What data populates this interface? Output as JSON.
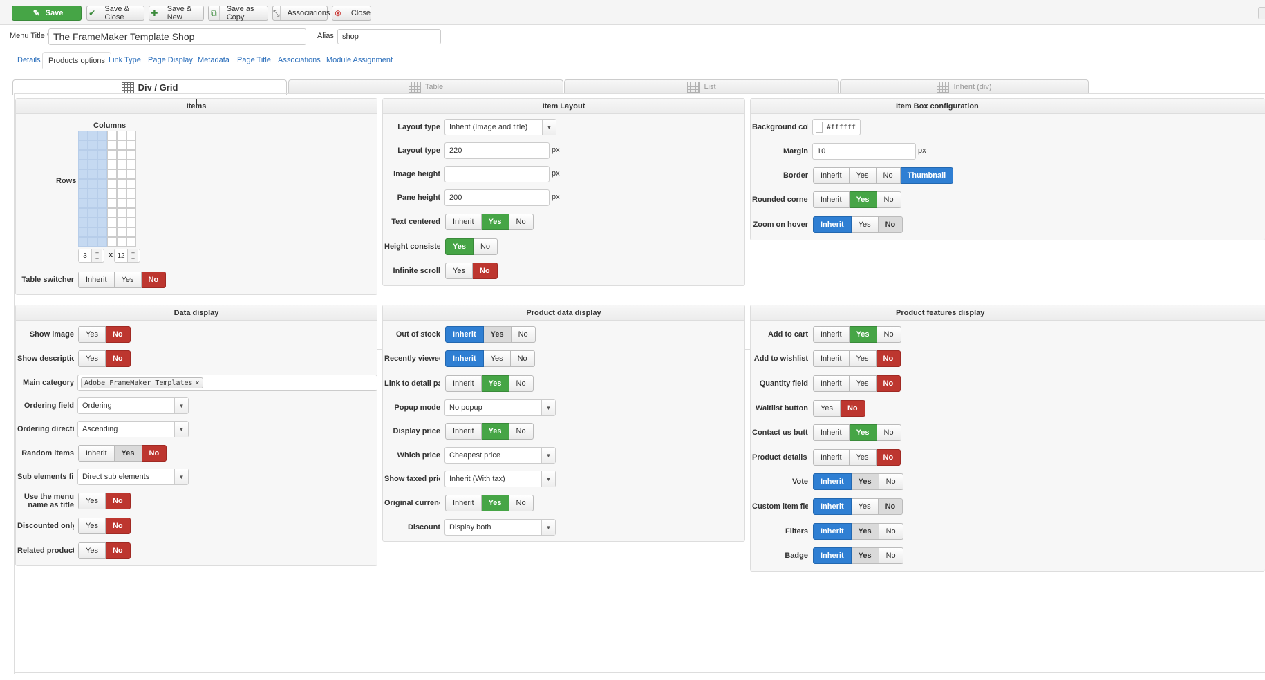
{
  "toolbar": {
    "save": "Save",
    "save_close": "Save & Close",
    "save_new": "Save & New",
    "save_copy": "Save as Copy",
    "associations": "Associations",
    "close": "Close"
  },
  "form": {
    "menu_title_label": "Menu Title *",
    "menu_title_value": "The FrameMaker Template Shop",
    "alias_label": "Alias",
    "alias_value": "shop"
  },
  "tabs": [
    "Details",
    "Products options",
    "Link Type",
    "Page Display",
    "Metadata",
    "Page Title",
    "Associations",
    "Module Assignment"
  ],
  "active_tab": "Products options",
  "layout_tabs": [
    "Div / Grid",
    "Table",
    "List",
    "Inherit (div)"
  ],
  "active_layout_tab": "Div / Grid",
  "items": {
    "title": "Items",
    "columns_label": "Columns",
    "rows_label": "Rows",
    "columns": 3,
    "rows": 12,
    "times": "x",
    "table_switcher": {
      "label": "Table switcher",
      "options": [
        "Inherit",
        "Yes",
        "No"
      ],
      "selected": "No"
    }
  },
  "item_layout": {
    "title": "Item Layout",
    "layout_type_select": {
      "label": "Layout type",
      "value": "Inherit (Image and title)"
    },
    "layout_type_px": {
      "label": "Layout type",
      "value": "220",
      "unit": "px"
    },
    "image_height": {
      "label": "Image height",
      "value": "",
      "unit": "px"
    },
    "pane_height": {
      "label": "Pane height",
      "value": "200",
      "unit": "px"
    },
    "text_centered": {
      "label": "Text centered",
      "options": [
        "Inherit",
        "Yes",
        "No"
      ],
      "selected": "Yes"
    },
    "height_consistency": {
      "label": "Height consistency",
      "options": [
        "Yes",
        "No"
      ],
      "selected": "Yes"
    },
    "infinite_scroll": {
      "label": "Infinite scroll",
      "options": [
        "Yes",
        "No"
      ],
      "selected": "No"
    }
  },
  "item_box": {
    "title": "Item Box configuration",
    "background_color": {
      "label": "Background color",
      "value": "#ffffff"
    },
    "margin": {
      "label": "Margin",
      "value": "10",
      "unit": "px"
    },
    "border": {
      "label": "Border",
      "options": [
        "Inherit",
        "Yes",
        "No",
        "Thumbnail"
      ],
      "selected": "Thumbnail"
    },
    "rounded_corners": {
      "label": "Rounded corners",
      "options": [
        "Inherit",
        "Yes",
        "No"
      ],
      "selected": "Yes"
    },
    "zoom_on_hover": {
      "label": "Zoom on hover",
      "options": [
        "Inherit",
        "Yes",
        "No"
      ],
      "selected": "Inherit"
    }
  },
  "data_display": {
    "title": "Data display",
    "show_image": {
      "label": "Show image",
      "options": [
        "Yes",
        "No"
      ],
      "selected": "No"
    },
    "show_description": {
      "label": "Show description",
      "options": [
        "Yes",
        "No"
      ],
      "selected": "No"
    },
    "main_category": {
      "label": "Main category",
      "tag": "Adobe FrameMaker Templates",
      "remove": "×"
    },
    "ordering_field": {
      "label": "Ordering field",
      "value": "Ordering"
    },
    "ordering_direction": {
      "label": "Ordering direction",
      "value": "Ascending"
    },
    "random_items": {
      "label": "Random items",
      "options": [
        "Inherit",
        "Yes",
        "No"
      ],
      "selected": "No"
    },
    "sub_elements_filter": {
      "label": "Sub elements filter",
      "value": "Direct sub elements"
    },
    "use_menu_name_line1": "Use the menu",
    "use_menu_name_line2": "name as title",
    "use_menu_name": {
      "options": [
        "Yes",
        "No"
      ],
      "selected": "No"
    },
    "discounted_only": {
      "label": "Discounted only",
      "options": [
        "Yes",
        "No"
      ],
      "selected": "No"
    },
    "related_products": {
      "label": "Related products f",
      "options": [
        "Yes",
        "No"
      ],
      "selected": "No"
    }
  },
  "product_data": {
    "title": "Product data display",
    "out_of_stock": {
      "label": "Out of stock",
      "options": [
        "Inherit",
        "Yes",
        "No"
      ],
      "selected": "Inherit"
    },
    "recently_viewed": {
      "label": "Recently viewed",
      "options": [
        "Inherit",
        "Yes",
        "No"
      ],
      "selected": "Inherit"
    },
    "link_to_detail": {
      "label": "Link to detail page",
      "options": [
        "Inherit",
        "Yes",
        "No"
      ],
      "selected": "Yes"
    },
    "popup_mode": {
      "label": "Popup mode",
      "value": "No popup"
    },
    "display_price": {
      "label": "Display price",
      "options": [
        "Inherit",
        "Yes",
        "No"
      ],
      "selected": "Yes"
    },
    "which_price": {
      "label": "Which price",
      "value": "Cheapest price"
    },
    "show_taxed_prices": {
      "label": "Show taxed prices",
      "value": "Inherit (With tax)"
    },
    "original_currency": {
      "label": "Original currency",
      "options": [
        "Inherit",
        "Yes",
        "No"
      ],
      "selected": "Yes"
    },
    "discount": {
      "label": "Discount",
      "value": "Display both"
    }
  },
  "product_features": {
    "title": "Product features display",
    "add_to_cart": {
      "label": "Add to cart",
      "options": [
        "Inherit",
        "Yes",
        "No"
      ],
      "selected": "Yes"
    },
    "add_to_wishlist": {
      "label": "Add to wishlist",
      "options": [
        "Inherit",
        "Yes",
        "No"
      ],
      "selected": "No"
    },
    "quantity_field": {
      "label": "Quantity field",
      "options": [
        "Inherit",
        "Yes",
        "No"
      ],
      "selected": "No"
    },
    "waitlist_button": {
      "label": "Waitlist button",
      "options": [
        "Yes",
        "No"
      ],
      "selected": "No"
    },
    "contact_us_button": {
      "label": "Contact us button",
      "options": [
        "Inherit",
        "Yes",
        "No"
      ],
      "selected": "Yes"
    },
    "product_details_button": {
      "label": "Product details but",
      "options": [
        "Inherit",
        "Yes",
        "No"
      ],
      "selected": "No"
    },
    "vote": {
      "label": "Vote",
      "options": [
        "Inherit",
        "Yes",
        "No"
      ],
      "selected": "Inherit"
    },
    "custom_item_fields": {
      "label": "Custom item fields",
      "options": [
        "Inherit",
        "Yes",
        "No"
      ],
      "selected": "Inherit"
    },
    "filters": {
      "label": "Filters",
      "options": [
        "Inherit",
        "Yes",
        "No"
      ],
      "selected": "Inherit"
    },
    "badge": {
      "label": "Badge",
      "options": [
        "Inherit",
        "Yes",
        "No"
      ],
      "selected": "Inherit"
    }
  },
  "colors": {
    "green": "#46a546",
    "red": "#bd362f",
    "blue": "#2f7fd3",
    "link": "#2a6ebb"
  }
}
